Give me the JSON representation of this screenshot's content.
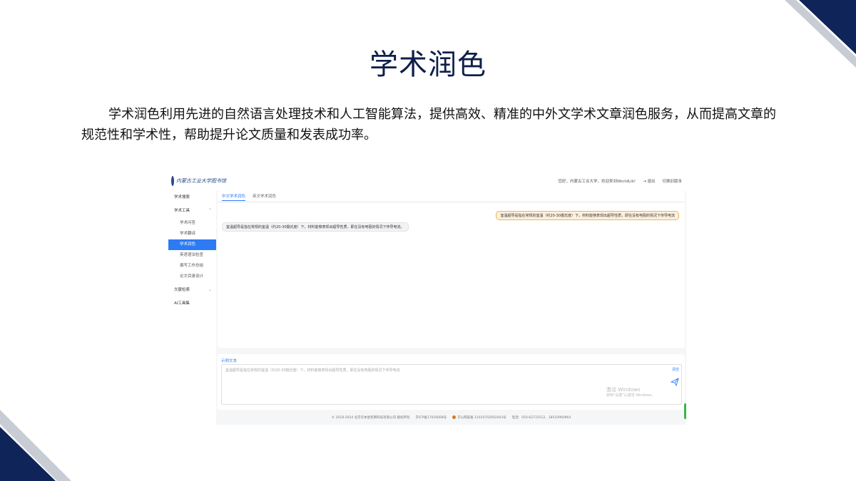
{
  "slide": {
    "title": "学术润色",
    "description": "学术润色利用先进的自然语言处理技术和人工智能算法，提供高效、精准的中外文学术文章润色服务，从而提高文章的规范性和学术性，帮助提升论文质量和发表成功率。"
  },
  "colors": {
    "navy": "#0f2459",
    "grey_band": "#c8ccd4",
    "accent": "#2d7bf4",
    "user_bubble": "#fdf0dc"
  },
  "app": {
    "logo_text": "内蒙古工业大学图书馆",
    "header": {
      "greeting": "您好，内蒙古工业大学，欢迎来到WorldLib!",
      "logout": "退出",
      "switch_version": "切换旧版本"
    },
    "sidebar": {
      "items": [
        {
          "label": "学术搜索"
        },
        {
          "label": "学术工具",
          "expanded": true
        },
        {
          "label": "文献检索",
          "expanded": false
        },
        {
          "label": "AI工具集"
        }
      ],
      "sub_items": [
        {
          "label": "学术问答"
        },
        {
          "label": "学术翻译"
        },
        {
          "label": "学术润色",
          "active": true
        },
        {
          "label": "英语语法检查"
        },
        {
          "label": "撰写工作总结"
        },
        {
          "label": "论文目录设计"
        }
      ]
    },
    "tabs": [
      {
        "label": "中文学术润色",
        "active": true
      },
      {
        "label": "英文学术润色",
        "active": false
      }
    ],
    "chat": {
      "user_message": "室温超导是指在常规的室温（约20-30摄氏度）下，材料能够表现出超导性质，即在没有电阻的情况下传导电流",
      "bot_message": "室温超导是指在常规的室温（约20-30摄氏度）下，材料能够表现出超导性质，即在没有电阻的情况下传导电流。"
    },
    "input": {
      "label": "示例文本",
      "placeholder": "室温超导是指在常规的室温（约20-30摄氏度）下，材料能够表现出超导性质，即在没有电阻的情况下传导电流",
      "clear": "清空",
      "send_icon": "paper-plane-icon"
    },
    "watermark": {
      "line1": "激活 Windows",
      "line2": "转到\"设置\"以激活 Windows。"
    },
    "footer": {
      "copyright": "© 2018-2024 北京华本星凯网科技有限公司 版权所有",
      "icp": "京ICP备17016668号",
      "police": "京公网安备 11010702002043号",
      "phone": "电话：010-62731512、18510960964"
    }
  }
}
